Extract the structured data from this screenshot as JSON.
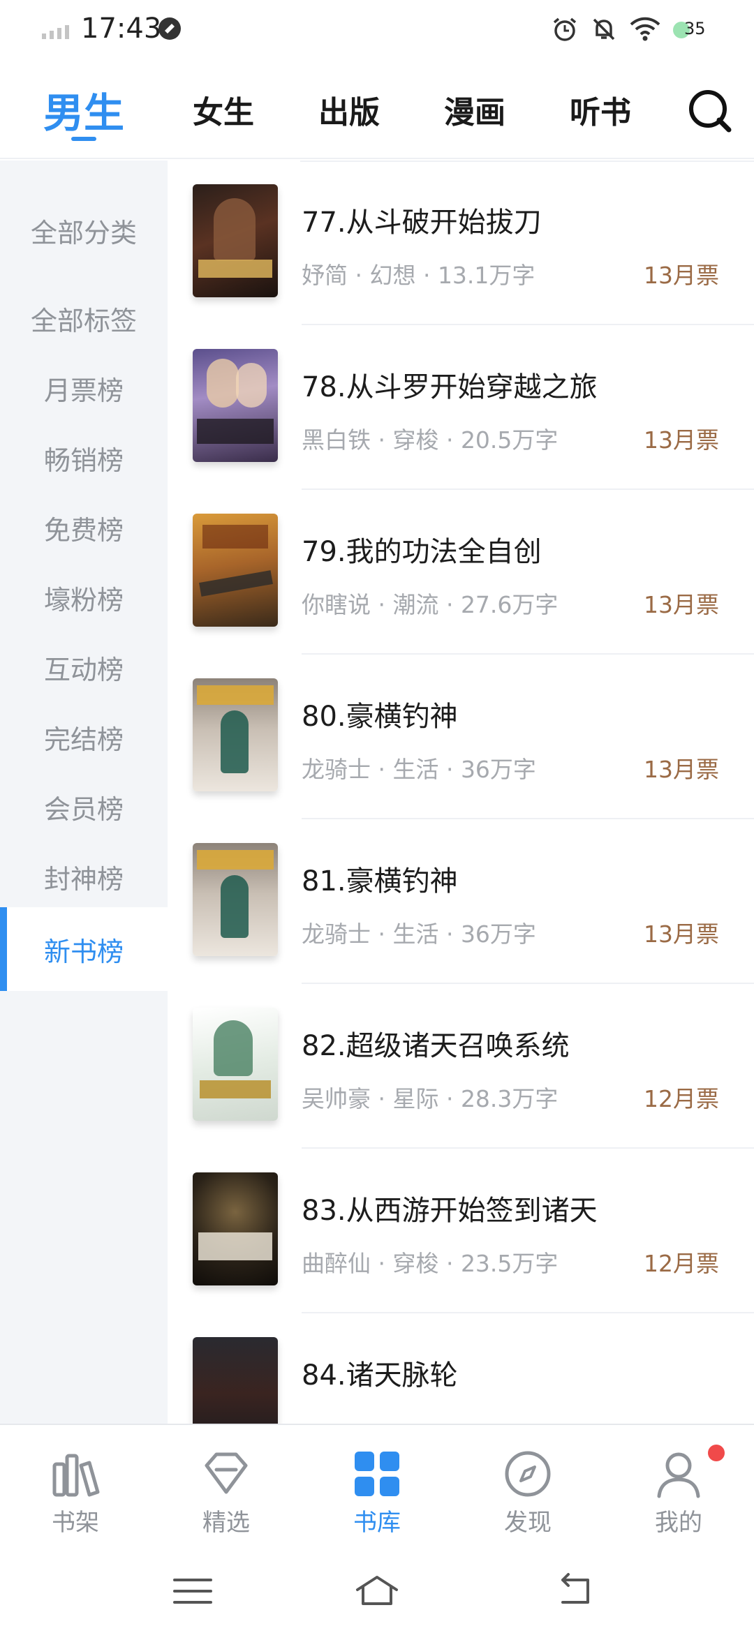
{
  "status_bar": {
    "time": "17:43",
    "battery": "35"
  },
  "top_tabs": [
    {
      "label": "男生",
      "active": true
    },
    {
      "label": "女生",
      "active": false
    },
    {
      "label": "出版",
      "active": false
    },
    {
      "label": "漫画",
      "active": false
    },
    {
      "label": "听书",
      "active": false
    }
  ],
  "sidebar": [
    {
      "label": "全部分类"
    },
    {
      "label": "全部标签"
    },
    {
      "label": "月票榜"
    },
    {
      "label": "畅销榜"
    },
    {
      "label": "免费榜"
    },
    {
      "label": "壕粉榜"
    },
    {
      "label": "互动榜"
    },
    {
      "label": "完结榜"
    },
    {
      "label": "会员榜"
    },
    {
      "label": "封神榜"
    },
    {
      "label": "新书榜",
      "active": true
    }
  ],
  "books": [
    {
      "title": "77.从斗破开始拔刀",
      "meta": "妤简 · 幻想 · 13.1万字",
      "votes": "13月票"
    },
    {
      "title": "78.从斗罗开始穿越之旅",
      "meta": "黑白铁 · 穿梭 · 20.5万字",
      "votes": "13月票"
    },
    {
      "title": "79.我的功法全自创",
      "meta": "你瞎说 · 潮流 · 27.6万字",
      "votes": "13月票"
    },
    {
      "title": "80.豪横钓神",
      "meta": "龙骑士 · 生活 · 36万字",
      "votes": "13月票"
    },
    {
      "title": "81.豪横钓神",
      "meta": "龙骑士 · 生活 · 36万字",
      "votes": "13月票"
    },
    {
      "title": "82.超级诸天召唤系统",
      "meta": "吴帅豪 · 星际 · 28.3万字",
      "votes": "12月票"
    },
    {
      "title": "83.从西游开始签到诸天",
      "meta": "曲醉仙 · 穿梭 · 23.5万字",
      "votes": "12月票"
    },
    {
      "title": "84.诸天脉轮",
      "meta": "",
      "votes": ""
    }
  ],
  "bottom_nav": [
    {
      "label": "书架",
      "icon": "bookshelf-icon"
    },
    {
      "label": "精选",
      "icon": "diamond-icon"
    },
    {
      "label": "书库",
      "icon": "grid-icon",
      "active": true
    },
    {
      "label": "发现",
      "icon": "compass-icon"
    },
    {
      "label": "我的",
      "icon": "user-icon"
    }
  ],
  "colors": {
    "accent": "#2f8ef0",
    "votes": "#9a6a45",
    "badge": "#f04a4a"
  }
}
